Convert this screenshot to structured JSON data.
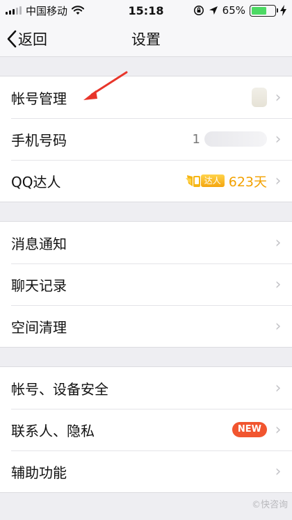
{
  "status_bar": {
    "carrier": "中国移动",
    "time": "15:18",
    "battery_percent": "65%",
    "battery_level": 0.65
  },
  "nav": {
    "back_label": "返回",
    "title": "设置"
  },
  "groups": [
    {
      "rows": [
        {
          "label": "帐号管理"
        },
        {
          "label": "手机号码",
          "value": "1"
        },
        {
          "label": "QQ达人",
          "badge": "达人",
          "days": "623天"
        }
      ]
    },
    {
      "rows": [
        {
          "label": "消息通知"
        },
        {
          "label": "聊天记录"
        },
        {
          "label": "空间清理"
        }
      ]
    },
    {
      "rows": [
        {
          "label": "帐号、设备安全"
        },
        {
          "label": "联系人、隐私",
          "badge": "NEW"
        },
        {
          "label": "辅助功能"
        }
      ]
    }
  ],
  "watermark": "©快咨询",
  "colors": {
    "accent_gold": "#f2a100",
    "new_badge": "#f1552f",
    "arrow": "#e8352a",
    "battery": "#4cd964"
  },
  "icons": {
    "back": "chevron-left-icon",
    "row_arrow": "chevron-right-icon",
    "wifi": "wifi-icon",
    "lock_rotation": "rotation-lock-icon",
    "location": "location-icon",
    "charging": "charging-bolt-icon"
  }
}
